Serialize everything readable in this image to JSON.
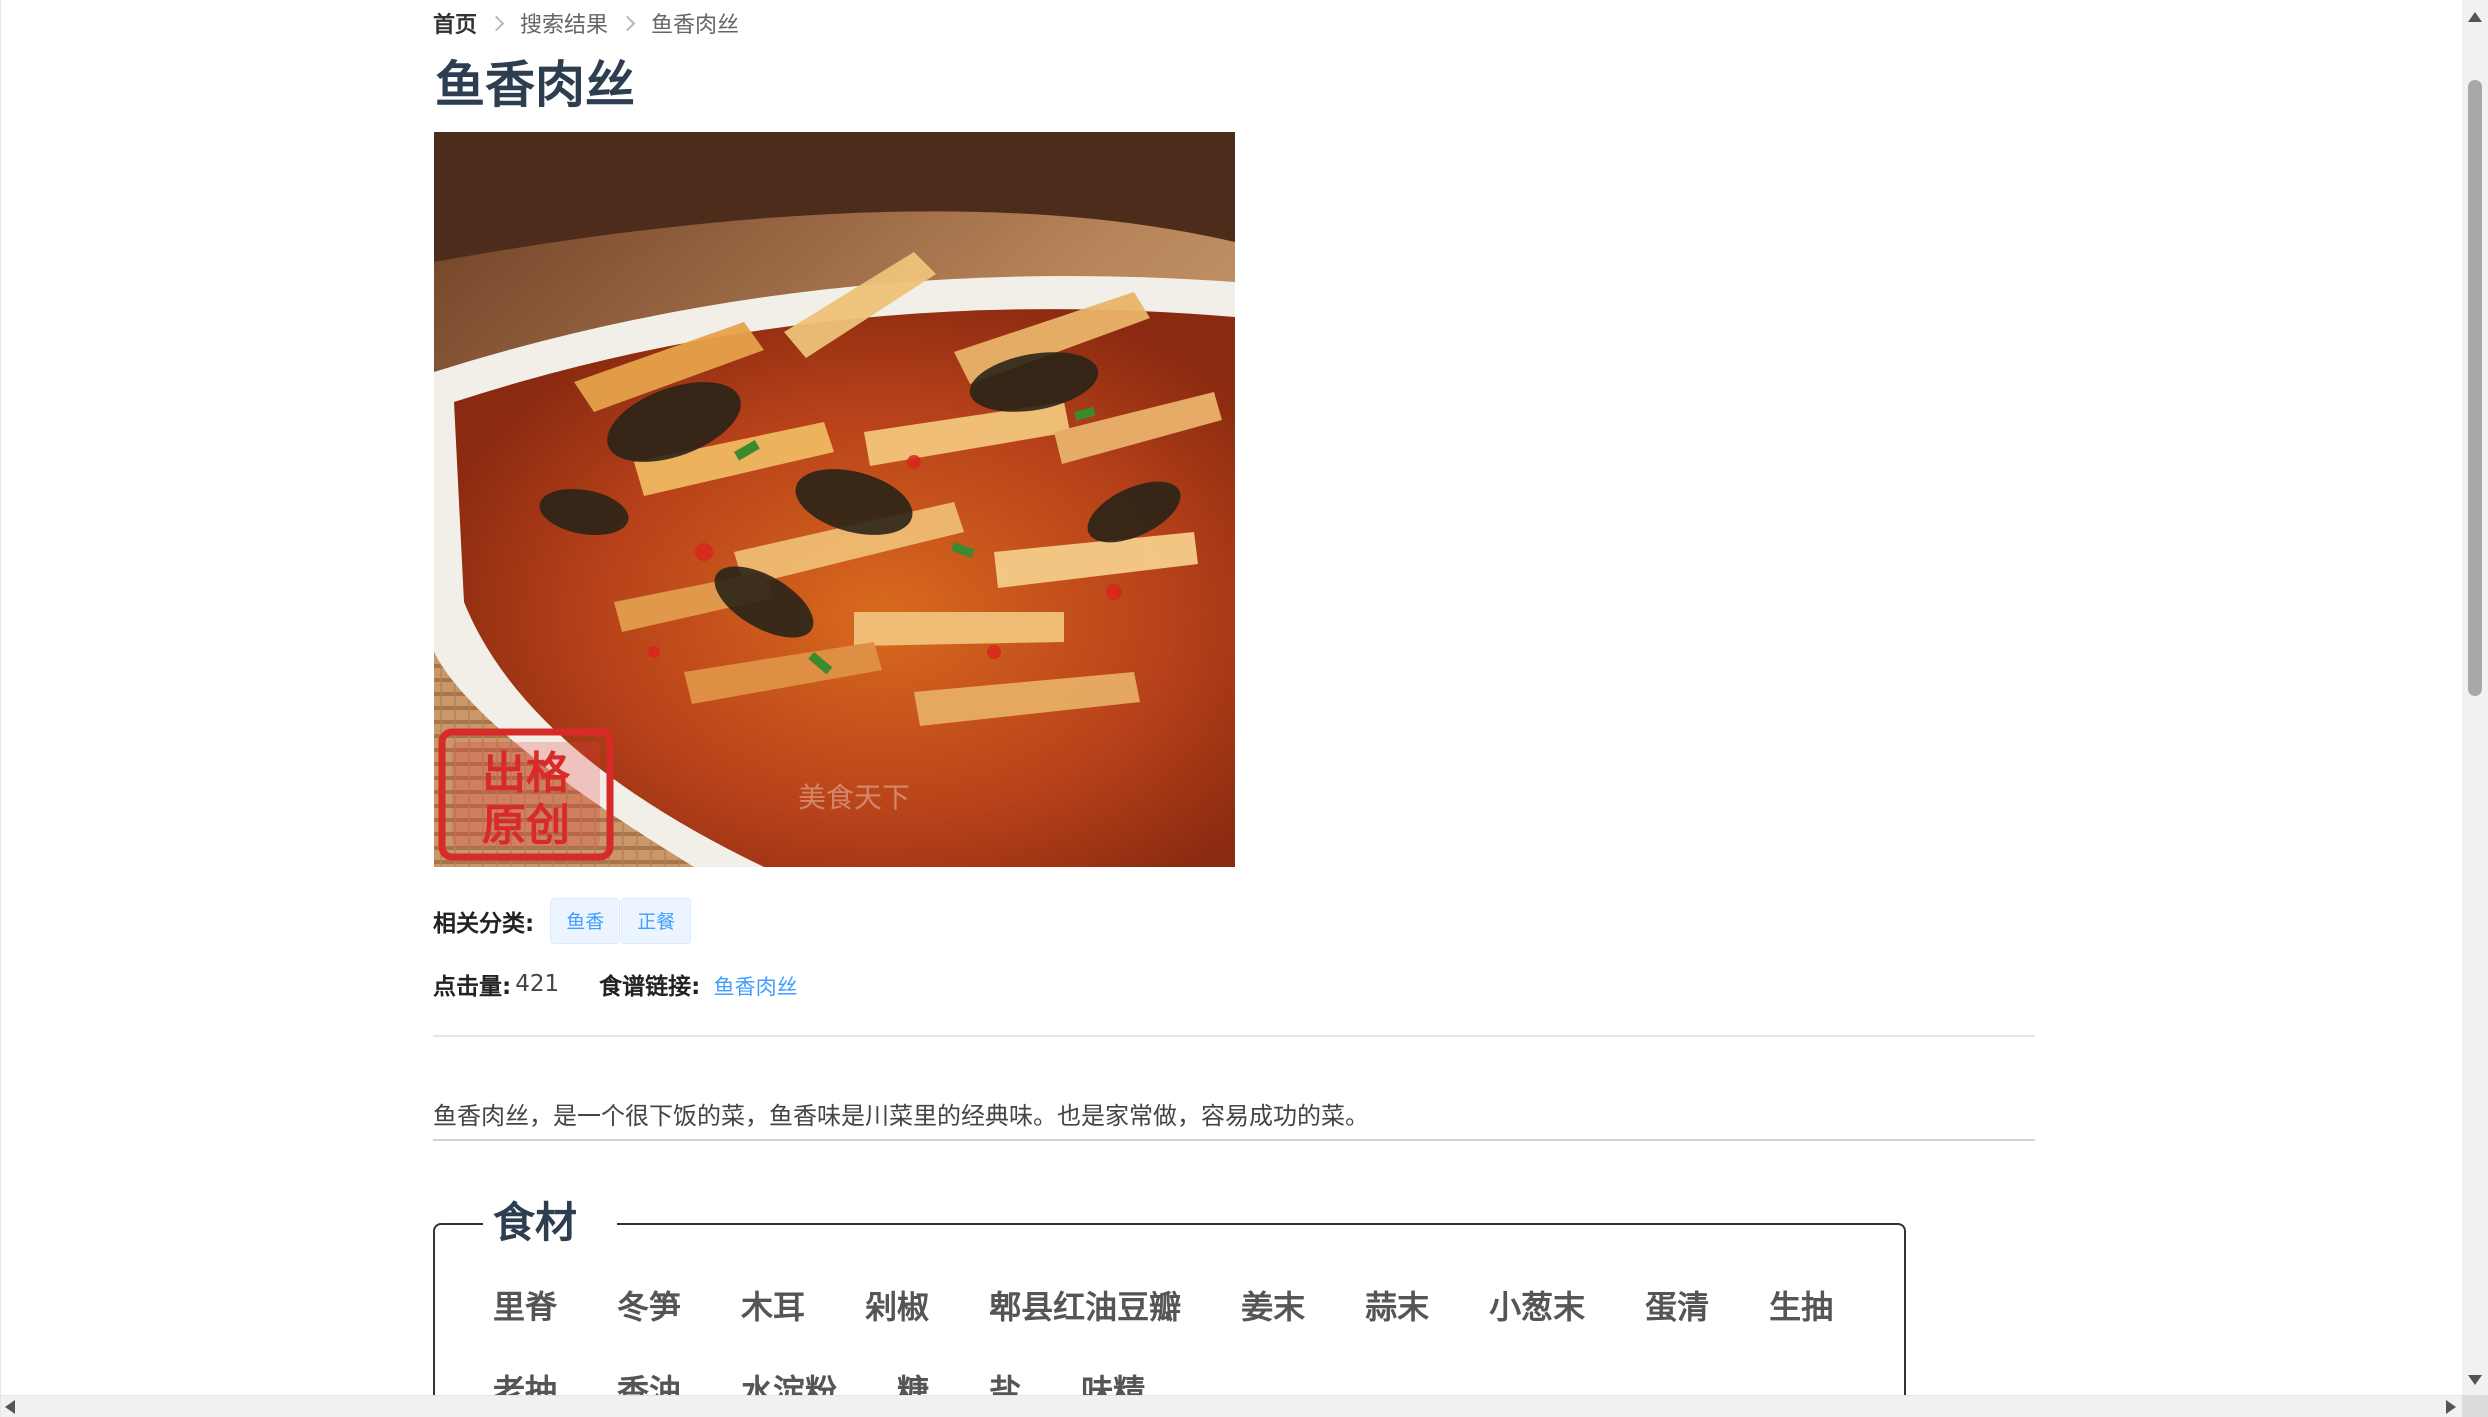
{
  "breadcrumb": {
    "home": "首页",
    "search_results": "搜索结果",
    "current": "鱼香肉丝"
  },
  "recipe": {
    "title": "鱼香肉丝",
    "image_alt": "鱼香肉丝",
    "category_label": "相关分类:",
    "categories": [
      "鱼香",
      "正餐"
    ],
    "clicks_label": "点击量:",
    "clicks_value": "421",
    "link_label": "食谱链接:",
    "link_text": "鱼香肉丝",
    "description": "鱼香肉丝，是一个很下饭的菜，鱼香味是川菜里的经典味。也是家常做，容易成功的菜。",
    "image_watermark": "美食天下",
    "image_stamp": [
      "出",
      "格",
      "原",
      "创"
    ]
  },
  "ingredients": {
    "heading": "食材",
    "items": [
      "里脊",
      "冬笋",
      "木耳",
      "剁椒",
      "郫县红油豆瓣",
      "姜末",
      "蒜末",
      "小葱末",
      "蛋清",
      "生抽",
      "老抽",
      "香油",
      "水淀粉",
      "糖",
      "盐",
      "味精"
    ]
  },
  "colors": {
    "title": "#2c3e50",
    "link": "#409eff",
    "tag_bg": "#ecf5ff",
    "divider": "#e4e7ed"
  }
}
